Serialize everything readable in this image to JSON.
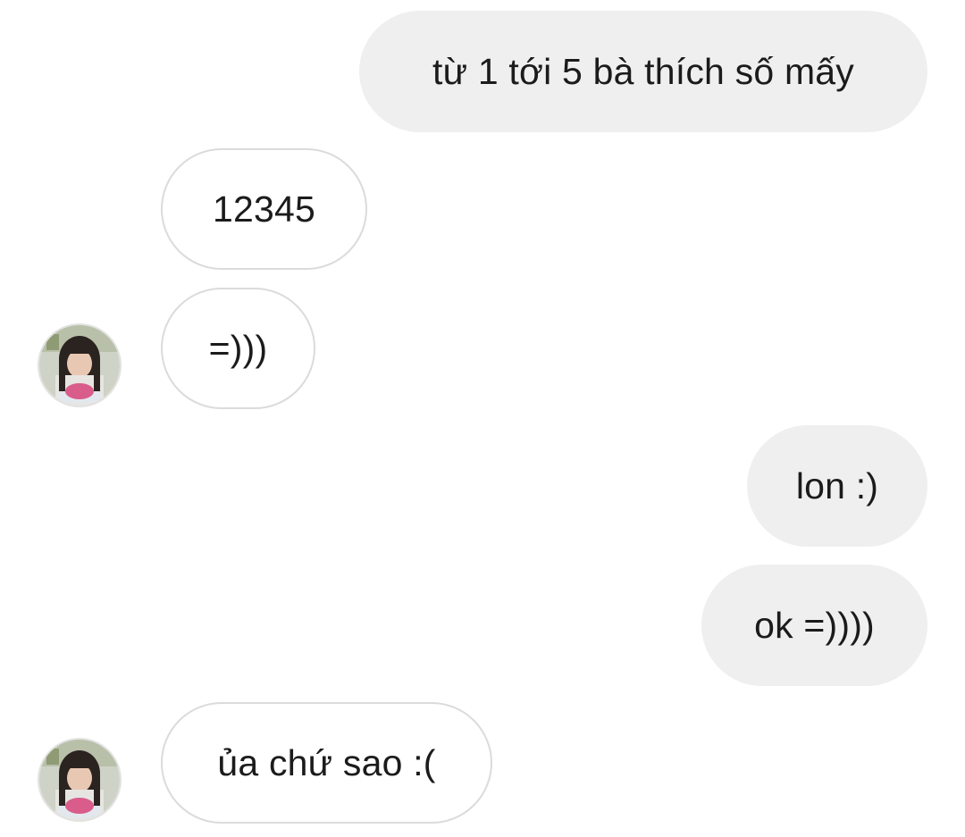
{
  "conversation": {
    "messages": [
      {
        "sender": "me",
        "text": "từ 1 tới 5 bà thích số mấy"
      },
      {
        "sender": "other",
        "text": "12345"
      },
      {
        "sender": "other",
        "text": "=)))"
      },
      {
        "sender": "me",
        "text": "lon :)"
      },
      {
        "sender": "me",
        "text": "ok =))))"
      },
      {
        "sender": "other",
        "text": "ủa chứ sao :("
      }
    ]
  },
  "theme": {
    "outgoing_bubble": "#efefef",
    "incoming_bubble": "#ffffff",
    "incoming_border": "#dbdbdb",
    "text_color": "#1b1b1b"
  },
  "icons": {
    "contact_avatar": "profile-photo"
  }
}
